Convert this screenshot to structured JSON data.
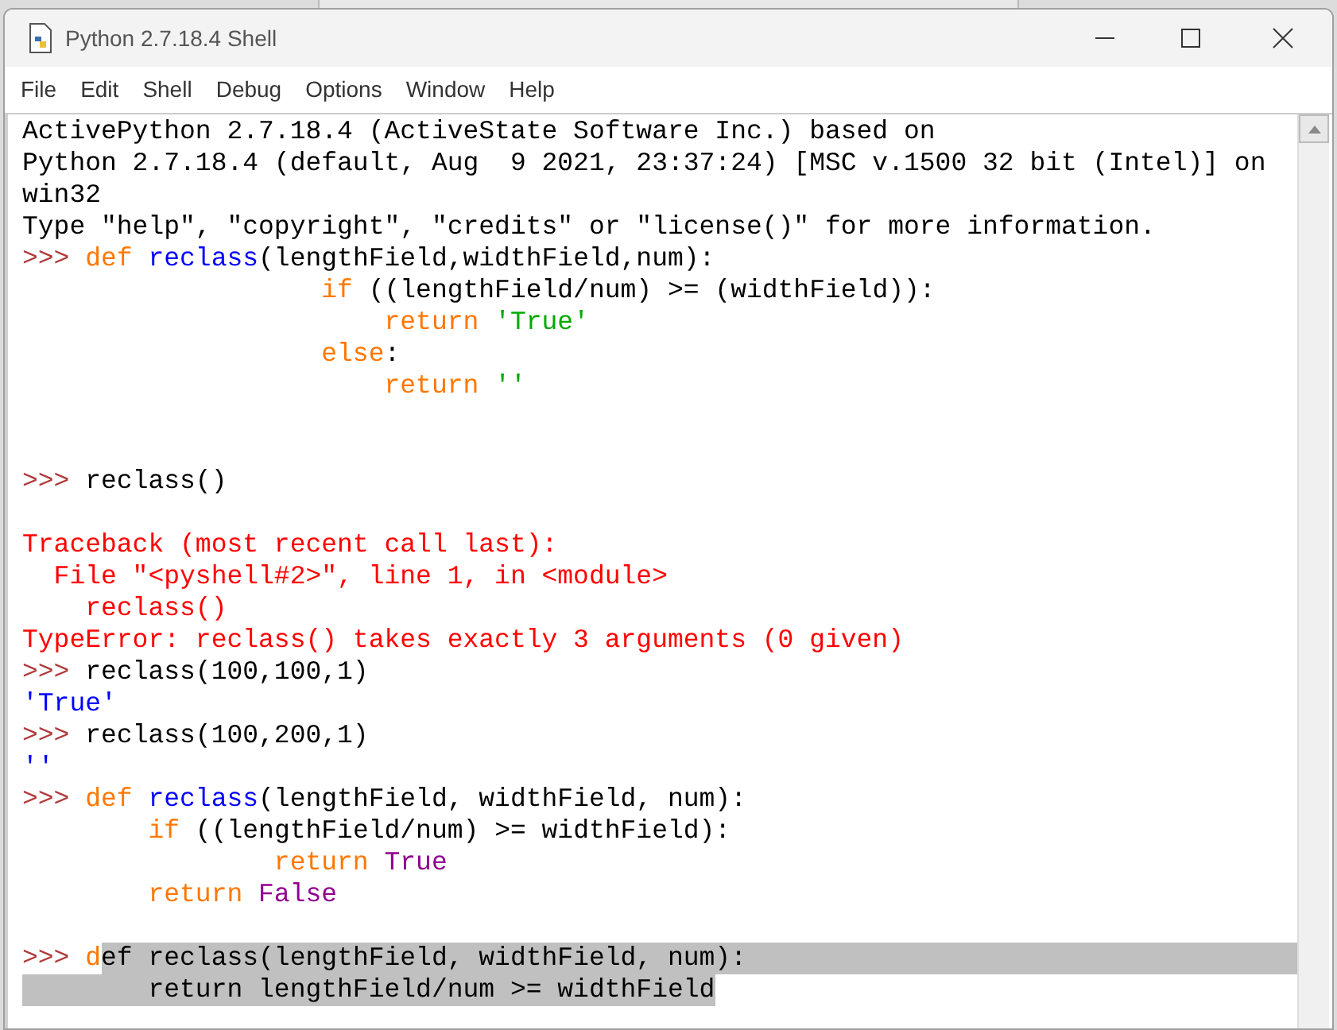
{
  "window": {
    "title": "Python 2.7.18.4 Shell"
  },
  "menu": [
    "File",
    "Edit",
    "Shell",
    "Debug",
    "Options",
    "Window",
    "Help"
  ],
  "lines": [
    {
      "selected": false,
      "segments": [
        {
          "kind": "output",
          "text": "ActivePython 2.7.18.4 (ActiveState Software Inc.) based on",
          "selected": false
        }
      ]
    },
    {
      "selected": false,
      "segments": [
        {
          "kind": "output",
          "text": "Python 2.7.18.4 (default, Aug  9 2021, 23:37:24) [MSC v.1500 32 bit (Intel)] on",
          "selected": false
        }
      ]
    },
    {
      "selected": false,
      "segments": [
        {
          "kind": "output",
          "text": "win32",
          "selected": false
        }
      ]
    },
    {
      "selected": false,
      "segments": [
        {
          "kind": "output",
          "text": "Type \"help\", \"copyright\", \"credits\" or \"license()\" for more information.",
          "selected": false
        }
      ]
    },
    {
      "selected": false,
      "segments": [
        {
          "kind": "prompt",
          "text": ">>> ",
          "selected": false
        },
        {
          "kind": "keyword",
          "text": "def ",
          "selected": false
        },
        {
          "kind": "definition",
          "text": "reclass",
          "selected": false
        },
        {
          "kind": "plain",
          "text": "(lengthField,widthField,num):",
          "selected": false
        }
      ]
    },
    {
      "selected": false,
      "segments": [
        {
          "kind": "keyword",
          "text": "                   if",
          "selected": false
        },
        {
          "kind": "plain",
          "text": " ((lengthField/num) >= (widthField)):",
          "selected": false
        }
      ]
    },
    {
      "selected": false,
      "segments": [
        {
          "kind": "keyword",
          "text": "                       return ",
          "selected": false
        },
        {
          "kind": "string",
          "text": "'True'",
          "selected": false
        }
      ]
    },
    {
      "selected": false,
      "segments": [
        {
          "kind": "keyword",
          "text": "                   else",
          "selected": false
        },
        {
          "kind": "plain",
          "text": ":",
          "selected": false
        }
      ]
    },
    {
      "selected": false,
      "segments": [
        {
          "kind": "keyword",
          "text": "                       return ",
          "selected": false
        },
        {
          "kind": "string",
          "text": "''",
          "selected": false
        }
      ]
    },
    {
      "selected": false
    },
    {
      "selected": false
    },
    {
      "selected": false,
      "segments": [
        {
          "kind": "prompt",
          "text": ">>> ",
          "selected": false
        },
        {
          "kind": "plain",
          "text": "reclass()",
          "selected": false
        }
      ]
    },
    {
      "selected": false
    },
    {
      "selected": false,
      "segments": [
        {
          "kind": "error",
          "text": "Traceback (most recent call last):",
          "selected": false
        }
      ]
    },
    {
      "selected": false,
      "segments": [
        {
          "kind": "error",
          "text": "  File \"<pyshell#2>\", line 1, in <module>",
          "selected": false
        }
      ]
    },
    {
      "selected": false,
      "segments": [
        {
          "kind": "error",
          "text": "    reclass()",
          "selected": false
        }
      ]
    },
    {
      "selected": false,
      "segments": [
        {
          "kind": "error",
          "text": "TypeError: reclass() takes exactly 3 arguments (0 given)",
          "selected": false
        }
      ]
    },
    {
      "selected": false,
      "segments": [
        {
          "kind": "prompt",
          "text": ">>> ",
          "selected": false
        },
        {
          "kind": "plain",
          "text": "reclass(100,100,1)",
          "selected": false
        }
      ]
    },
    {
      "selected": false,
      "segments": [
        {
          "kind": "stdout",
          "text": "'True'",
          "selected": false
        }
      ]
    },
    {
      "selected": false,
      "segments": [
        {
          "kind": "prompt",
          "text": ">>> ",
          "selected": false
        },
        {
          "kind": "plain",
          "text": "reclass(100,200,1)",
          "selected": false
        }
      ]
    },
    {
      "selected": false,
      "segments": [
        {
          "kind": "stdout",
          "text": "''",
          "selected": false
        }
      ]
    },
    {
      "selected": false,
      "segments": [
        {
          "kind": "prompt",
          "text": ">>> ",
          "selected": false
        },
        {
          "kind": "keyword",
          "text": "def ",
          "selected": false
        },
        {
          "kind": "definition",
          "text": "reclass",
          "selected": false
        },
        {
          "kind": "plain",
          "text": "(lengthField, widthField, num):",
          "selected": false
        }
      ]
    },
    {
      "selected": false,
      "segments": [
        {
          "kind": "keyword",
          "text": "        if",
          "selected": false
        },
        {
          "kind": "plain",
          "text": " ((lengthField/num) >= widthField):",
          "selected": false
        }
      ]
    },
    {
      "selected": false,
      "segments": [
        {
          "kind": "keyword",
          "text": "                return ",
          "selected": false
        },
        {
          "kind": "builtin",
          "text": "True",
          "selected": false
        }
      ]
    },
    {
      "selected": false,
      "segments": [
        {
          "kind": "keyword",
          "text": "        return ",
          "selected": false
        },
        {
          "kind": "builtin",
          "text": "False",
          "selected": false
        }
      ]
    },
    {
      "selected": false
    },
    {
      "selected": true,
      "segments": [
        {
          "kind": "prompt",
          "text": ">>> ",
          "selected": false
        },
        {
          "kind": "keyword",
          "text": "d",
          "selected": false
        },
        {
          "kind": "plain",
          "text": "ef reclass(lengthField, widthField, num):",
          "selected": true
        }
      ]
    },
    {
      "selected": false,
      "segments": [
        {
          "kind": "plain",
          "text": "        return lengthField/num >= widthField",
          "selected": true
        }
      ]
    }
  ]
}
